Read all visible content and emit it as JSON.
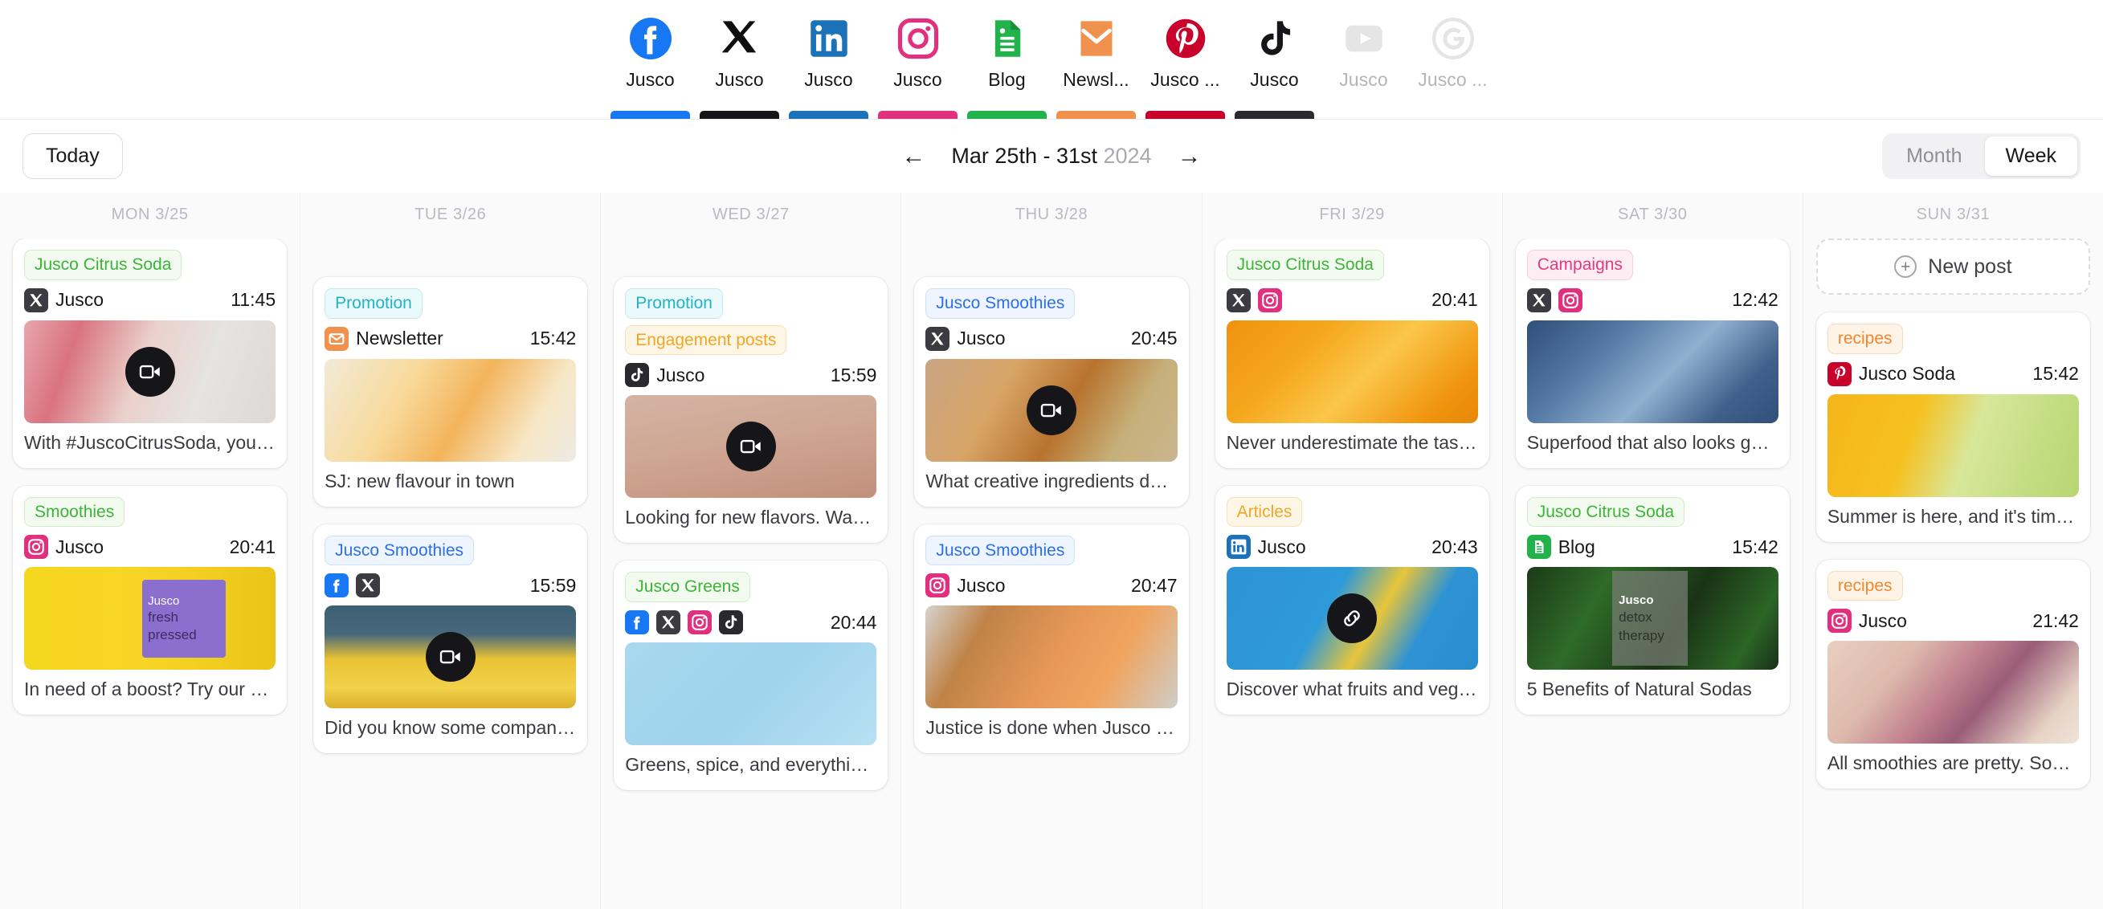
{
  "channels": [
    {
      "name": "facebook-icon",
      "label": "Jusco",
      "accent": "#1877F2",
      "dim": false
    },
    {
      "name": "x-icon",
      "label": "Jusco",
      "accent": "#15151A",
      "dim": false
    },
    {
      "name": "linkedin-icon",
      "label": "Jusco",
      "accent": "#1B72B8",
      "dim": false
    },
    {
      "name": "instagram-icon",
      "label": "Jusco",
      "accent": "#E0307E",
      "dim": false
    },
    {
      "name": "blog-icon",
      "label": "Blog",
      "accent": "#22B24C",
      "dim": false
    },
    {
      "name": "newsletter-icon",
      "label": "Newsl...",
      "accent": "#F0924D",
      "dim": false
    },
    {
      "name": "pinterest-icon",
      "label": "Jusco ...",
      "accent": "#C8022A",
      "dim": false
    },
    {
      "name": "tiktok-icon",
      "label": "Jusco",
      "accent": "#2A2A2E",
      "dim": false
    },
    {
      "name": "youtube-icon",
      "label": "Jusco",
      "accent": "#B6B6BC",
      "dim": true
    },
    {
      "name": "google-icon",
      "label": "Jusco ...",
      "accent": "#B6B6BC",
      "dim": true
    }
  ],
  "toolbar": {
    "today_label": "Today",
    "prev_arrow": "←",
    "next_arrow": "→",
    "date_range": "Mar 25th - 31st",
    "year": "2024",
    "month_label": "Month",
    "week_label": "Week",
    "active_view": "Week"
  },
  "new_post": {
    "label": "New post",
    "plus": "+"
  },
  "days": [
    {
      "header": "MON 3/25",
      "posts": [
        {
          "tags": [
            {
              "text": "Jusco Citrus Soda",
              "color": "green"
            }
          ],
          "platforms": [
            "x-icon"
          ],
          "account": "Jusco",
          "time": "11:45",
          "media": "video",
          "thumb": "pink-cocktail",
          "caption": "With #JuscoCitrusSoda, you alw..."
        },
        {
          "tags": [
            {
              "text": "Smoothies",
              "color": "green"
            }
          ],
          "platforms": [
            "instagram-icon"
          ],
          "account": "Jusco",
          "time": "20:41",
          "media": "none",
          "thumb": "yellow-bottle",
          "caption": "In need of a boost? Try our delic..."
        }
      ]
    },
    {
      "header": "TUE 3/26",
      "posts": [
        {
          "tags": [
            {
              "text": "Promotion",
              "color": "teal"
            }
          ],
          "platforms": [
            "newsletter-icon"
          ],
          "account": "Newsletter",
          "time": "15:42",
          "media": "none",
          "thumb": "orange-juice-glass",
          "caption": "SJ: new flavour in town"
        },
        {
          "tags": [
            {
              "text": "Jusco Smoothies",
              "color": "blue"
            }
          ],
          "platforms": [
            "facebook-icon",
            "x-icon"
          ],
          "account": "",
          "time": "15:59",
          "media": "video",
          "thumb": "pineapples",
          "caption": "Did you know some company ha..."
        }
      ]
    },
    {
      "header": "WED 3/27",
      "posts": [
        {
          "tags": [
            {
              "text": "Promotion",
              "color": "teal"
            },
            {
              "text": "Engagement posts",
              "color": "amber"
            }
          ],
          "platforms": [
            "tiktok-icon"
          ],
          "account": "Jusco",
          "time": "15:59",
          "media": "video",
          "thumb": "portrait-face",
          "caption": "Looking for new flavors. Want to..."
        },
        {
          "tags": [
            {
              "text": "Jusco Greens",
              "color": "green"
            }
          ],
          "platforms": [
            "facebook-icon",
            "x-icon",
            "instagram-icon",
            "tiktok-icon"
          ],
          "account": "",
          "time": "20:44",
          "media": "none",
          "thumb": "lime-mint-blue",
          "caption": "Greens, spice, and everything ni..."
        }
      ]
    },
    {
      "header": "THU 3/28",
      "posts": [
        {
          "tags": [
            {
              "text": "Jusco Smoothies",
              "color": "blue"
            }
          ],
          "platforms": [
            "x-icon"
          ],
          "account": "Jusco",
          "time": "20:45",
          "media": "video",
          "thumb": "smoothie-cups",
          "caption": "What creative ingredients do yo..."
        },
        {
          "tags": [
            {
              "text": "Jusco Smoothies",
              "color": "blue"
            }
          ],
          "platforms": [
            "instagram-icon"
          ],
          "account": "Jusco",
          "time": "20:47",
          "media": "none",
          "thumb": "orange-wood-board",
          "caption": "Justice is done when Jusco is se..."
        }
      ]
    },
    {
      "header": "FRI 3/29",
      "posts": [
        {
          "tags": [
            {
              "text": "Jusco Citrus Soda",
              "color": "green"
            }
          ],
          "platforms": [
            "x-icon",
            "instagram-icon"
          ],
          "account": "",
          "time": "20:41",
          "media": "none",
          "thumb": "orange-slices",
          "caption": "Never underestimate the tastine..."
        },
        {
          "tags": [
            {
              "text": "Articles",
              "color": "amber"
            }
          ],
          "platforms": [
            "linkedin-icon"
          ],
          "account": "Jusco",
          "time": "20:43",
          "media": "link",
          "thumb": "banana-splash-blue",
          "caption": "Discover what fruits and veggies..."
        }
      ]
    },
    {
      "header": "SAT 3/30",
      "posts": [
        {
          "tags": [
            {
              "text": "Campaigns",
              "color": "pink"
            }
          ],
          "platforms": [
            "x-icon",
            "instagram-icon"
          ],
          "account": "",
          "time": "12:42",
          "media": "none",
          "thumb": "blueberries",
          "caption": "Superfood that also looks good?..."
        },
        {
          "tags": [
            {
              "text": "Jusco Citrus Soda",
              "color": "green"
            }
          ],
          "platforms": [
            "blog-icon"
          ],
          "account": "Blog",
          "time": "15:42",
          "media": "none",
          "thumb": "detox-basil",
          "caption": "5 Benefits of Natural Sodas"
        }
      ]
    },
    {
      "header": "SUN 3/31",
      "new_post_slot": true,
      "posts": [
        {
          "tags": [
            {
              "text": "recipes",
              "color": "orange"
            }
          ],
          "platforms": [
            "pinterest-icon"
          ],
          "account": "Jusco Soda",
          "time": "15:42",
          "media": "none",
          "thumb": "summer-orange-drink",
          "caption": "Summer is here, and it's time to ..."
        },
        {
          "tags": [
            {
              "text": "recipes",
              "color": "orange"
            }
          ],
          "platforms": [
            "instagram-icon"
          ],
          "account": "Jusco",
          "time": "21:42",
          "media": "none",
          "thumb": "berry-smoothie-bowl",
          "caption": "All smoothies are pretty. Some a..."
        }
      ]
    }
  ]
}
